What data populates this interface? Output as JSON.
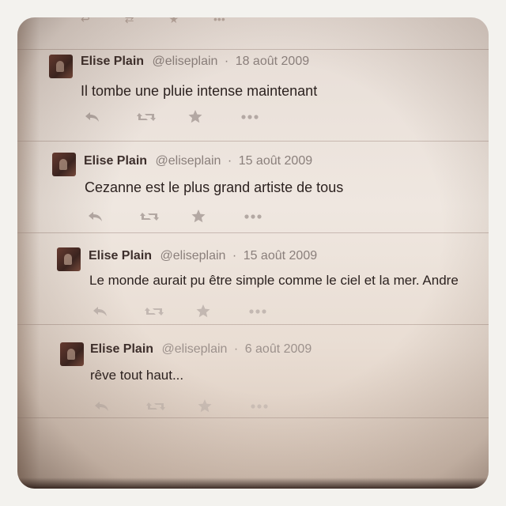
{
  "tweets": [
    {
      "name": "Elise Plain",
      "handle": "@eliseplain",
      "separator": "·",
      "date": "18 août 2009",
      "text": "Il tombe une pluie intense maintenant"
    },
    {
      "name": "Elise Plain",
      "handle": "@eliseplain",
      "separator": "·",
      "date": "15 août 2009",
      "text": "Cezanne est le plus grand artiste de tous"
    },
    {
      "name": "Elise Plain",
      "handle": "@eliseplain",
      "separator": "·",
      "date": "15 août 2009",
      "text": "Le monde aurait pu être simple comme le ciel et la mer. Andre"
    },
    {
      "name": "Elise Plain",
      "handle": "@eliseplain",
      "separator": "·",
      "date": "6 août 2009",
      "text": "rêve tout haut..."
    }
  ],
  "action_icons": [
    "reply-icon",
    "retweet-icon",
    "favorite-icon",
    "more-icon"
  ],
  "colors": {
    "name": "#3d2f2c",
    "meta": "#8a7f7b",
    "text": "#2c2220",
    "icon": "#b3a8a3"
  }
}
